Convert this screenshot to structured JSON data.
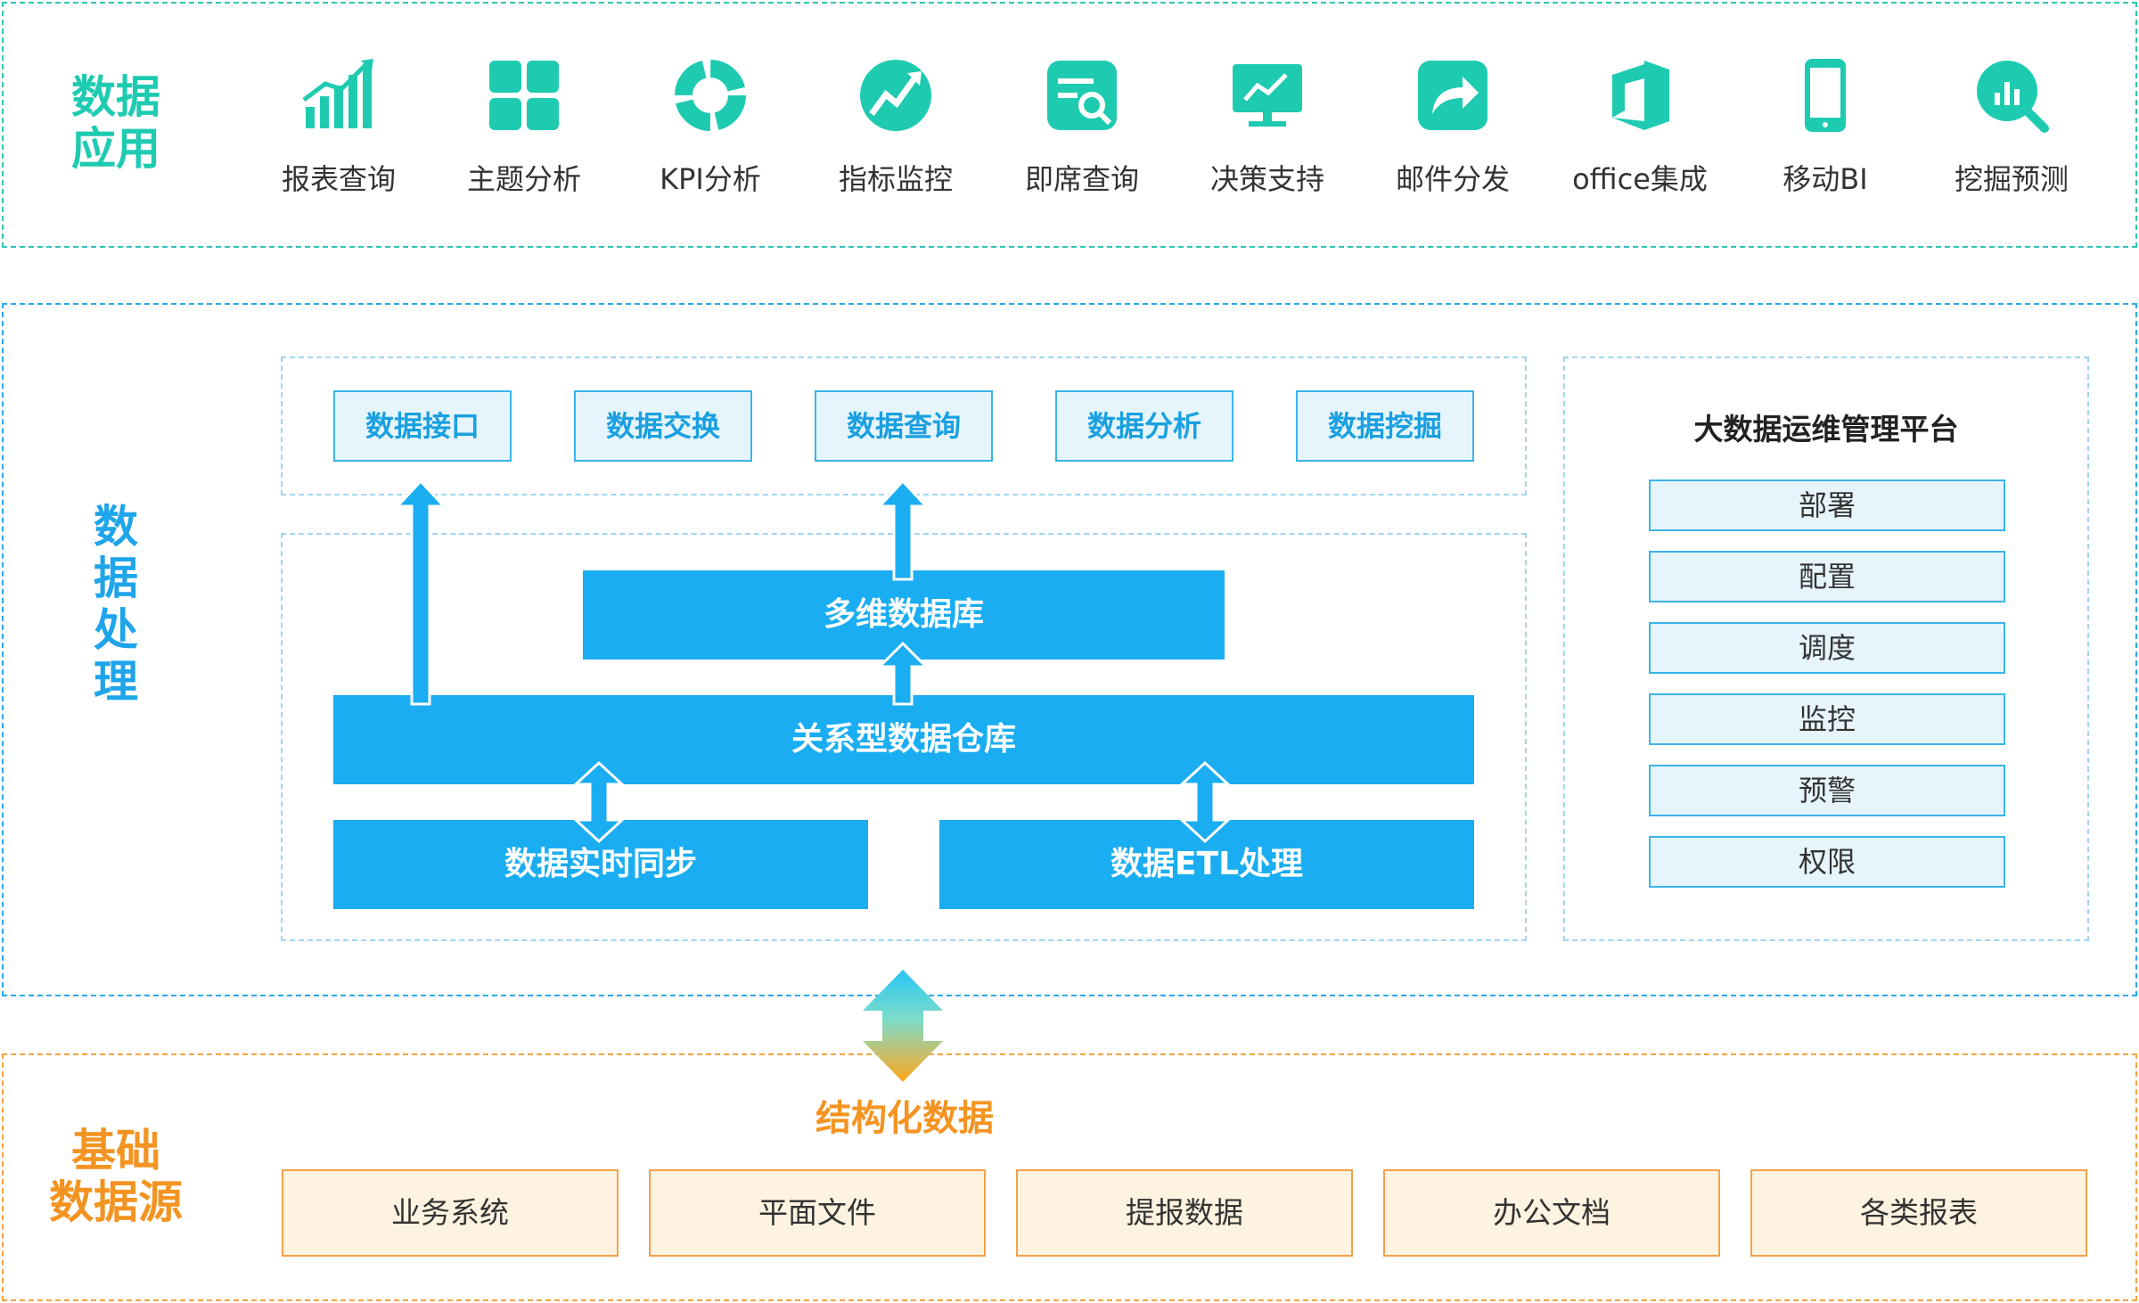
{
  "sections": {
    "app": {
      "label_line1": "数据",
      "label_line2": "应用"
    },
    "processing": {
      "label": [
        "数",
        "据",
        "处",
        "理"
      ]
    },
    "source": {
      "label_line1": "基础",
      "label_line2": "数据源"
    }
  },
  "apps": [
    {
      "name": "报表查询",
      "icon": "bar-chart-icon"
    },
    {
      "name": "主题分析",
      "icon": "grid-icon"
    },
    {
      "name": "KPI分析",
      "icon": "donut-icon"
    },
    {
      "name": "指标监控",
      "icon": "trend-circle-icon"
    },
    {
      "name": "即席查询",
      "icon": "search-doc-icon"
    },
    {
      "name": "决策支持",
      "icon": "monitor-chart-icon"
    },
    {
      "name": "邮件分发",
      "icon": "share-arrow-icon"
    },
    {
      "name": "office集成",
      "icon": "office-icon"
    },
    {
      "name": "移动BI",
      "icon": "mobile-icon"
    },
    {
      "name": "挖掘预测",
      "icon": "magnifier-chart-icon"
    }
  ],
  "services": [
    "数据接口",
    "数据交换",
    "数据查询",
    "数据分析",
    "数据挖掘"
  ],
  "layers": {
    "olap": "多维数据库",
    "warehouse": "关系型数据仓库",
    "realtime": "数据实时同步",
    "etl": "数据ETL处理"
  },
  "ops": {
    "title": "大数据运维管理平台",
    "items": [
      "部署",
      "配置",
      "调度",
      "监控",
      "预警",
      "权限"
    ]
  },
  "source": {
    "title": "结构化数据",
    "items": [
      "业务系统",
      "平面文件",
      "提报数据",
      "办公文档",
      "各类报表"
    ]
  },
  "colors": {
    "app_accent": "#1ecbb1",
    "processing_accent": "#1aadf1",
    "source_accent": "#f39422"
  }
}
